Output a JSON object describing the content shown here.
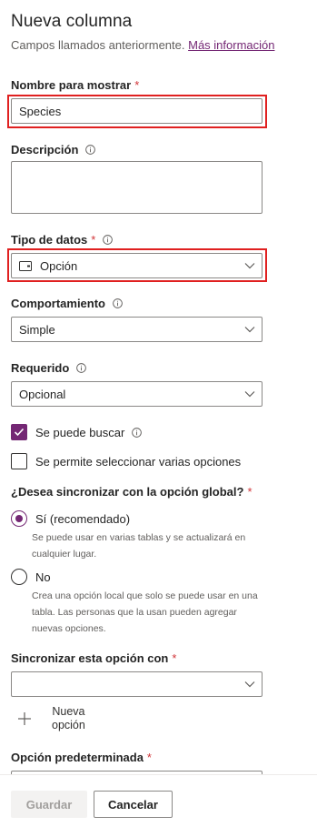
{
  "panel": {
    "title": "Nueva columna",
    "subtitle": "Campos llamados anteriormente.",
    "more_info_link": "Más información"
  },
  "display_name": {
    "label": "Nombre para mostrar",
    "required_mark": "*",
    "value": "Species"
  },
  "description": {
    "label": "Descripción",
    "value": ""
  },
  "data_type": {
    "label": "Tipo de datos",
    "required_mark": "*",
    "value": "Opción",
    "icon": "choice-icon"
  },
  "behavior": {
    "label": "Comportamiento",
    "value": "Simple"
  },
  "required": {
    "label": "Requerido",
    "value": "Opcional"
  },
  "searchable": {
    "label": "Se puede buscar",
    "checked": true
  },
  "multi_select": {
    "label": "Se permite seleccionar varias opciones",
    "checked": false
  },
  "global_sync": {
    "question": "¿Desea sincronizar con la opción global?",
    "required_mark": "*",
    "options": [
      {
        "label": "Sí (recomendado)",
        "selected": true,
        "helper": "Se puede usar en varias tablas y se actualizará en cualquier lugar."
      },
      {
        "label": "No",
        "selected": false,
        "helper": "Crea una opción local que solo se puede usar en una tabla. Las personas que la usan pueden agregar nuevas opciones."
      }
    ]
  },
  "sync_with": {
    "label": "Sincronizar esta opción con",
    "required_mark": "*",
    "value": ""
  },
  "new_choice": {
    "label_line1": "Nueva",
    "label_line2": "opción"
  },
  "default_choice": {
    "label": "Opción predeterminada",
    "required_mark": "*"
  },
  "footer": {
    "save_label": "Guardar",
    "cancel_label": "Cancelar"
  },
  "colors": {
    "accent": "#742774",
    "required": "#d13438",
    "highlight": "#e02020"
  }
}
